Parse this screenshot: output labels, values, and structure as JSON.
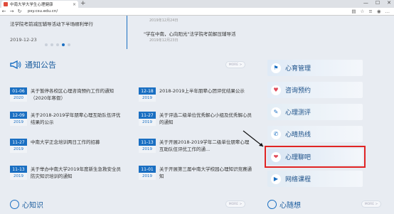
{
  "browser": {
    "tab_title": "中南大学大学生心理健康",
    "tab_close": "×",
    "new_tab": "+",
    "minimize": "—",
    "maximize": "☐",
    "close": "✕",
    "url": "psy.csu.edu.cn/"
  },
  "news": {
    "left_text": "法学院考前减压辅导活动下半场顺利举行",
    "left_date": "2019-12-23",
    "right_date_top": "2019年12月24日",
    "right_title": "\"学在中南，心向阳光\"法学院考前解压辅导活",
    "right_date_bottom": "2019年12月23日"
  },
  "notice": {
    "title": "通知公告",
    "more": "MORE >",
    "left_items": [
      {
        "md": "01-06",
        "yr": "2020",
        "text": "关于暂停各校区心理咨询预约工作的通知（2020年寒假）"
      },
      {
        "md": "12-09",
        "yr": "2019",
        "text": "关于2018-2019学年朋辈心理互助队伍评优结果的公示"
      },
      {
        "md": "11-27",
        "yr": "2019",
        "text": "中南大学正念培训两日工作的招募"
      },
      {
        "md": "11-13",
        "yr": "2019",
        "text": "关于举办中南大学2019年度新生急救安全员防灾知识培训的通知"
      }
    ],
    "right_items": [
      {
        "md": "12-18",
        "yr": "2019",
        "text": "2018-2019上半年朋辈心团评优结果公示"
      },
      {
        "md": "11-27",
        "yr": "2019",
        "text": "关于评选二级单位优秀解心小组及优秀解心员的通知"
      },
      {
        "md": "11-13",
        "yr": "2019",
        "text": "关于开展2018-2019学年二级单位朋辈心理互助队伍评优工作的通..."
      },
      {
        "md": "11-01",
        "yr": "2019",
        "text": "关于开展第三届中南大学校园心理知识竞赛通知"
      }
    ]
  },
  "sidebar": {
    "items": [
      {
        "label": "心育管理",
        "icon": "⚑",
        "bg": "#dfeaf6"
      },
      {
        "label": "咨询预约",
        "icon": "♥",
        "bg": "#e4edf7"
      },
      {
        "label": "心理测评",
        "icon": "✎",
        "bg": "#e3edf5"
      },
      {
        "label": "心晴热线",
        "icon": "✆",
        "bg": "#e6eef6"
      },
      {
        "label": "心理聊吧",
        "icon": "❤",
        "bg": "#d7e4f3"
      },
      {
        "label": "网络课程",
        "icon": "▶",
        "bg": "#e1ebf4"
      }
    ]
  },
  "bottom": {
    "left_title": "心知识",
    "right_title": "心随想",
    "more": "MORE >"
  }
}
